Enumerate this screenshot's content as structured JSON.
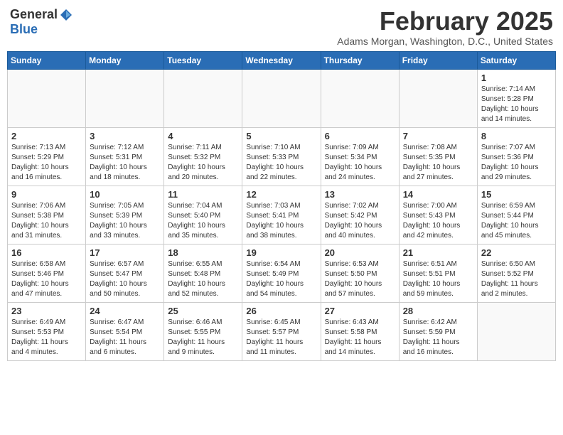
{
  "header": {
    "logo_general": "General",
    "logo_blue": "Blue",
    "month_title": "February 2025",
    "location": "Adams Morgan, Washington, D.C., United States"
  },
  "days_of_week": [
    "Sunday",
    "Monday",
    "Tuesday",
    "Wednesday",
    "Thursday",
    "Friday",
    "Saturday"
  ],
  "weeks": [
    [
      {
        "day": "",
        "info": ""
      },
      {
        "day": "",
        "info": ""
      },
      {
        "day": "",
        "info": ""
      },
      {
        "day": "",
        "info": ""
      },
      {
        "day": "",
        "info": ""
      },
      {
        "day": "",
        "info": ""
      },
      {
        "day": "1",
        "info": "Sunrise: 7:14 AM\nSunset: 5:28 PM\nDaylight: 10 hours and 14 minutes."
      }
    ],
    [
      {
        "day": "2",
        "info": "Sunrise: 7:13 AM\nSunset: 5:29 PM\nDaylight: 10 hours and 16 minutes."
      },
      {
        "day": "3",
        "info": "Sunrise: 7:12 AM\nSunset: 5:31 PM\nDaylight: 10 hours and 18 minutes."
      },
      {
        "day": "4",
        "info": "Sunrise: 7:11 AM\nSunset: 5:32 PM\nDaylight: 10 hours and 20 minutes."
      },
      {
        "day": "5",
        "info": "Sunrise: 7:10 AM\nSunset: 5:33 PM\nDaylight: 10 hours and 22 minutes."
      },
      {
        "day": "6",
        "info": "Sunrise: 7:09 AM\nSunset: 5:34 PM\nDaylight: 10 hours and 24 minutes."
      },
      {
        "day": "7",
        "info": "Sunrise: 7:08 AM\nSunset: 5:35 PM\nDaylight: 10 hours and 27 minutes."
      },
      {
        "day": "8",
        "info": "Sunrise: 7:07 AM\nSunset: 5:36 PM\nDaylight: 10 hours and 29 minutes."
      }
    ],
    [
      {
        "day": "9",
        "info": "Sunrise: 7:06 AM\nSunset: 5:38 PM\nDaylight: 10 hours and 31 minutes."
      },
      {
        "day": "10",
        "info": "Sunrise: 7:05 AM\nSunset: 5:39 PM\nDaylight: 10 hours and 33 minutes."
      },
      {
        "day": "11",
        "info": "Sunrise: 7:04 AM\nSunset: 5:40 PM\nDaylight: 10 hours and 35 minutes."
      },
      {
        "day": "12",
        "info": "Sunrise: 7:03 AM\nSunset: 5:41 PM\nDaylight: 10 hours and 38 minutes."
      },
      {
        "day": "13",
        "info": "Sunrise: 7:02 AM\nSunset: 5:42 PM\nDaylight: 10 hours and 40 minutes."
      },
      {
        "day": "14",
        "info": "Sunrise: 7:00 AM\nSunset: 5:43 PM\nDaylight: 10 hours and 42 minutes."
      },
      {
        "day": "15",
        "info": "Sunrise: 6:59 AM\nSunset: 5:44 PM\nDaylight: 10 hours and 45 minutes."
      }
    ],
    [
      {
        "day": "16",
        "info": "Sunrise: 6:58 AM\nSunset: 5:46 PM\nDaylight: 10 hours and 47 minutes."
      },
      {
        "day": "17",
        "info": "Sunrise: 6:57 AM\nSunset: 5:47 PM\nDaylight: 10 hours and 50 minutes."
      },
      {
        "day": "18",
        "info": "Sunrise: 6:55 AM\nSunset: 5:48 PM\nDaylight: 10 hours and 52 minutes."
      },
      {
        "day": "19",
        "info": "Sunrise: 6:54 AM\nSunset: 5:49 PM\nDaylight: 10 hours and 54 minutes."
      },
      {
        "day": "20",
        "info": "Sunrise: 6:53 AM\nSunset: 5:50 PM\nDaylight: 10 hours and 57 minutes."
      },
      {
        "day": "21",
        "info": "Sunrise: 6:51 AM\nSunset: 5:51 PM\nDaylight: 10 hours and 59 minutes."
      },
      {
        "day": "22",
        "info": "Sunrise: 6:50 AM\nSunset: 5:52 PM\nDaylight: 11 hours and 2 minutes."
      }
    ],
    [
      {
        "day": "23",
        "info": "Sunrise: 6:49 AM\nSunset: 5:53 PM\nDaylight: 11 hours and 4 minutes."
      },
      {
        "day": "24",
        "info": "Sunrise: 6:47 AM\nSunset: 5:54 PM\nDaylight: 11 hours and 6 minutes."
      },
      {
        "day": "25",
        "info": "Sunrise: 6:46 AM\nSunset: 5:55 PM\nDaylight: 11 hours and 9 minutes."
      },
      {
        "day": "26",
        "info": "Sunrise: 6:45 AM\nSunset: 5:57 PM\nDaylight: 11 hours and 11 minutes."
      },
      {
        "day": "27",
        "info": "Sunrise: 6:43 AM\nSunset: 5:58 PM\nDaylight: 11 hours and 14 minutes."
      },
      {
        "day": "28",
        "info": "Sunrise: 6:42 AM\nSunset: 5:59 PM\nDaylight: 11 hours and 16 minutes."
      },
      {
        "day": "",
        "info": ""
      }
    ]
  ]
}
